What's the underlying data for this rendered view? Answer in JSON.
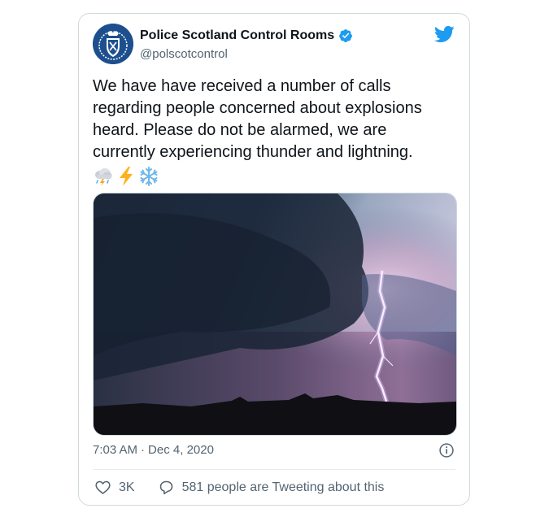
{
  "account": {
    "display_name": "Police Scotland Control Rooms",
    "handle": "@polscotcontrol",
    "verified": true,
    "avatar_icon": "police-scotland-crest-icon",
    "accent_color": "#1d9bf0"
  },
  "tweet": {
    "text": "We have have received a number of calls\nregarding people concerned about explosions\nheard. Please do not be alarmed, we are\ncurrently experiencing thunder and lightning.",
    "emojis": [
      "cloud-lightning-rain-icon",
      "high-voltage-icon",
      "snowflake-icon"
    ],
    "media_description_icon": "lightning-storm-photo",
    "time": "7:03 AM",
    "separator": "·",
    "date": "Dec 4, 2020"
  },
  "actions": {
    "likes": "3K",
    "conversation": "581 people are Tweeting about this"
  },
  "icons": {
    "logo": "twitter-bird-icon",
    "info": "info-icon",
    "like": "heart-icon",
    "reply": "comment-icon"
  }
}
